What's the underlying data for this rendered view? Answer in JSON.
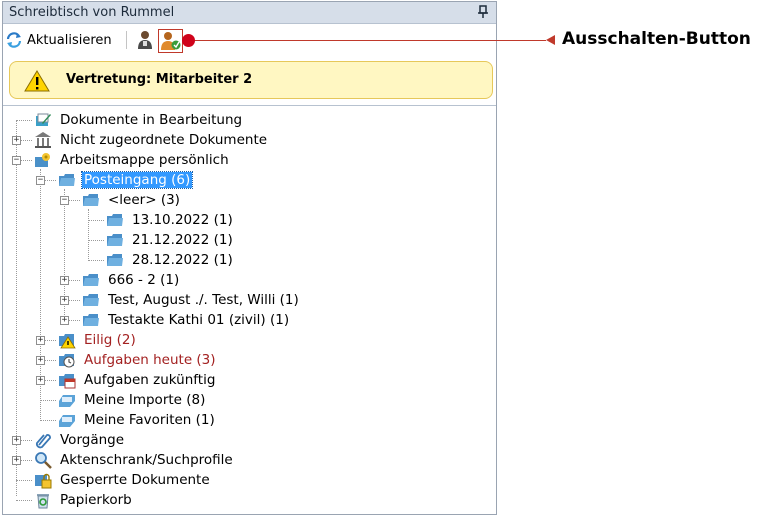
{
  "panel": {
    "title": "Schreibtisch von Rummel"
  },
  "toolbar": {
    "refresh_label": "Aktualisieren"
  },
  "banner": {
    "text": "Vertretung: Mitarbeiter 2"
  },
  "callout": {
    "label": "Ausschalten-Button"
  },
  "tree": {
    "items": [
      {
        "label": "Dokumente in Bearbeitung"
      },
      {
        "label": "Nicht zugeordnete Dokumente"
      },
      {
        "label": "Arbeitsmappe persönlich"
      },
      {
        "label": "Posteingang (6)"
      },
      {
        "label": "<leer> (3)"
      },
      {
        "label": "13.10.2022 (1)"
      },
      {
        "label": "21.12.2022 (1)"
      },
      {
        "label": "28.12.2022 (1)"
      },
      {
        "label": "666 - 2 (1)"
      },
      {
        "label": "Test, August ./. Test, Willi (1)"
      },
      {
        "label": "Testakte Kathi 01 (zivil) (1)"
      },
      {
        "label": "Eilig (2)"
      },
      {
        "label": "Aufgaben heute (3)"
      },
      {
        "label": "Aufgaben zukünftig"
      },
      {
        "label": "Meine Importe (8)"
      },
      {
        "label": "Meine Favoriten (1)"
      },
      {
        "label": "Vorgänge"
      },
      {
        "label": "Aktenschrank/Suchprofile"
      },
      {
        "label": "Gesperrte Dokumente"
      },
      {
        "label": "Papierkorb"
      }
    ]
  },
  "colors": {
    "selection": "#3399ff",
    "overdue_text": "#a32121",
    "callout": "#c0392b",
    "banner_bg": "#fff7c2"
  }
}
